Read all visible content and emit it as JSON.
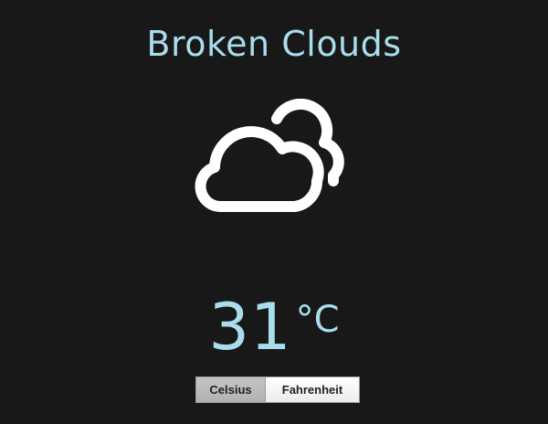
{
  "weather": {
    "condition": "Broken Clouds",
    "icon": "broken-clouds-icon",
    "temperature": "31",
    "unit_symbol": "°C"
  },
  "unit_toggle": {
    "celsius_label": "Celsius",
    "fahrenheit_label": "Fahrenheit",
    "selected": "Celsius"
  },
  "colors": {
    "background": "#181818",
    "accent": "#a9dcec",
    "icon": "#ffffff"
  }
}
